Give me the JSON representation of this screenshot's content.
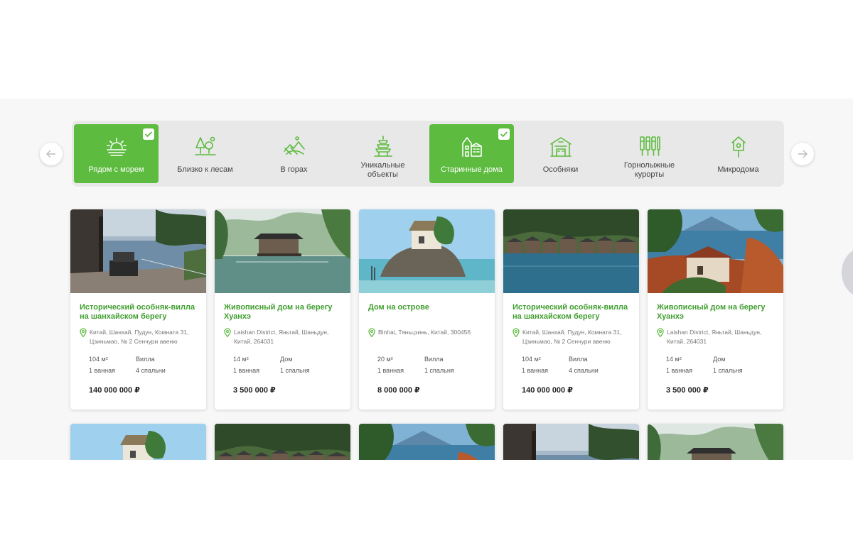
{
  "colors": {
    "accent": "#5dbb3f",
    "title_green": "#3f9e2e",
    "bar_bg": "#e8e8e8"
  },
  "nav": {
    "prev_icon": "arrow-left-icon",
    "next_icon": "arrow-right-icon"
  },
  "categories": [
    {
      "label": "Рядом с морем",
      "icon": "sea-sunset-icon",
      "active": true
    },
    {
      "label": "Близко к лесам",
      "icon": "forest-icon",
      "active": false
    },
    {
      "label": "В горах",
      "icon": "mountains-icon",
      "active": false
    },
    {
      "label": "Уникальные объекты",
      "icon": "pagoda-icon",
      "active": false
    },
    {
      "label": "Старинные дома",
      "icon": "old-house-icon",
      "active": true
    },
    {
      "label": "Особняки",
      "icon": "mansion-icon",
      "active": false
    },
    {
      "label": "Горнолыжные курорты",
      "icon": "ski-icon",
      "active": false
    },
    {
      "label": "Микродома",
      "icon": "birdhouse-icon",
      "active": false
    }
  ],
  "listings": [
    {
      "title": "Исторический особняк-вилла на шанхайском берегу",
      "address": "Китай, Шанхай, Пудун, Комната 31, Цзиньмао, № 2 Сенчури авеню",
      "area": "104 м²",
      "type": "Вилла",
      "baths": "1 ванная",
      "beds": "4 спальни",
      "price": "140 000 000 ₽",
      "photo": "terrace-sea"
    },
    {
      "title": "Живописный дом на берегу Хуанхэ",
      "address": "Laishan District, Яньтай, Шаньдун, Китай, 264031",
      "area": "14 м²",
      "type": "Дом",
      "baths": "1 ванная",
      "beds": "1 спальня",
      "price": "3 500 000 ₽",
      "photo": "pavilion-lake"
    },
    {
      "title": "Дом на острове",
      "address": "Binhai, Тяньцзинь, Китай, 300456",
      "area": "20 м²",
      "type": "Вилла",
      "baths": "1 ванная",
      "beds": "1 спальня",
      "price": "8 000 000 ₽",
      "photo": "island-rock"
    },
    {
      "title": "Исторический особняк-вилла на шанхайском берегу",
      "address": "Китай, Шанхай, Пудун, Комната 31, Цзиньмао, № 2 Сенчури авеню",
      "area": "104 м²",
      "type": "Вилла",
      "baths": "1 ванная",
      "beds": "4 спальни",
      "price": "140 000 000 ₽",
      "photo": "boathouses"
    },
    {
      "title": "Живописный дом на берегу Хуанхэ",
      "address": "Laishan District, Яньтай, Шаньдун, Китай, 264031",
      "area": "14 м²",
      "type": "Дом",
      "baths": "1 ванная",
      "beds": "1 спальня",
      "price": "3 500 000 ₽",
      "photo": "cliff-house"
    }
  ],
  "listings_row2": [
    {
      "photo": "island-rock"
    },
    {
      "photo": "boathouses"
    },
    {
      "photo": "cliff-house"
    },
    {
      "photo": "terrace-sea"
    },
    {
      "photo": "pavilion-lake"
    }
  ]
}
